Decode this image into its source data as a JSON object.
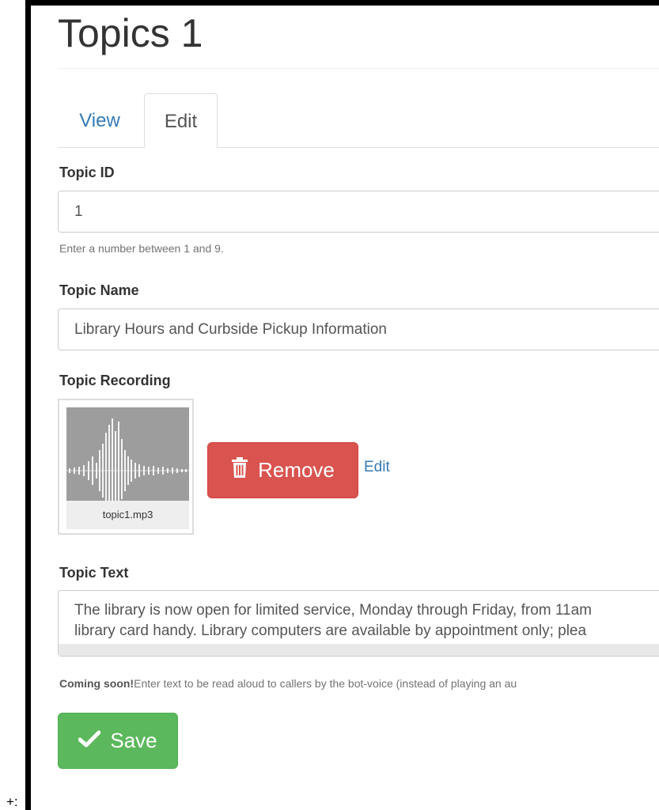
{
  "page": {
    "title": "Topics 1",
    "corner_text": "+:"
  },
  "tabs": [
    {
      "label": "View",
      "active": false
    },
    {
      "label": "Edit",
      "active": true
    }
  ],
  "form": {
    "topic_id": {
      "label": "Topic ID",
      "value": "1",
      "help": "Enter a number between 1 and 9."
    },
    "topic_name": {
      "label": "Topic Name",
      "value": "Library Hours and Curbside Pickup Information"
    },
    "topic_recording": {
      "label": "Topic Recording",
      "file_name": "topic1.mp3",
      "remove_label": "Remove",
      "edit_label": "Edit",
      "icon": "waveform-icon"
    },
    "topic_text": {
      "label": "Topic Text",
      "lines": [
        "The library is now open for limited service, Monday through Friday, from 11am",
        "library card handy.  Library computers are available by appointment only; plea"
      ],
      "help_bold": "Coming soon!",
      "help_text": "Enter text to be read aloud to callers by the bot-voice (instead of playing an au"
    },
    "save_label": "Save"
  },
  "colors": {
    "primary": "#337ab7",
    "danger": "#d9534f",
    "success": "#5cb85c"
  }
}
